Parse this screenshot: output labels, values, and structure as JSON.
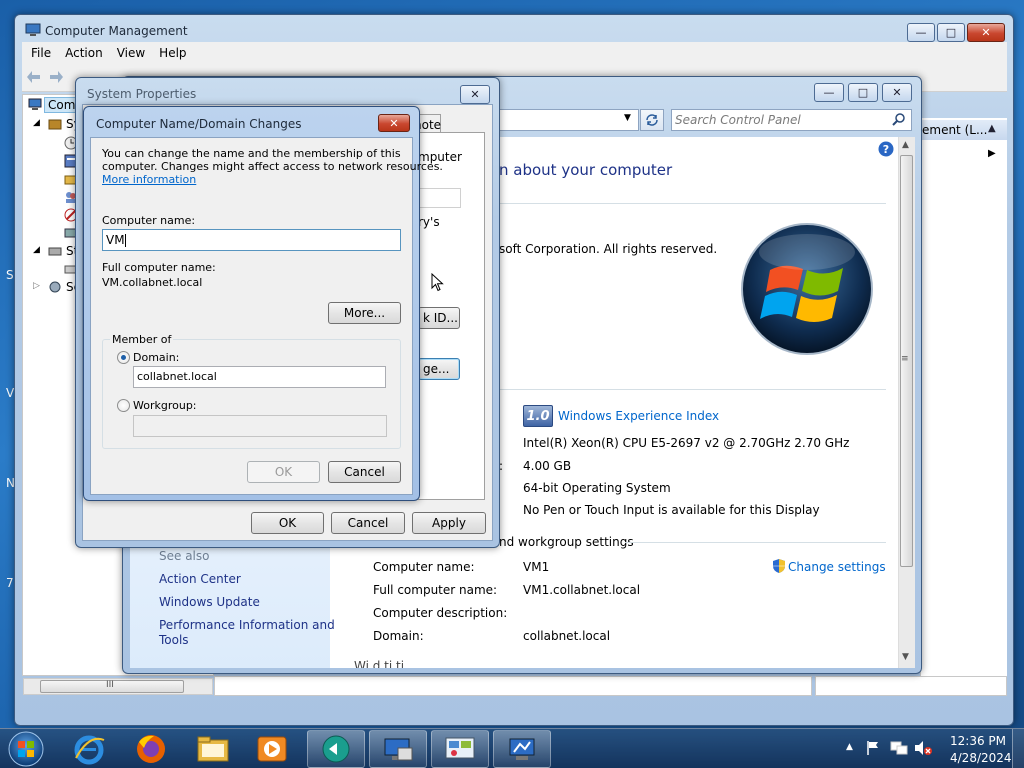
{
  "desktop": {
    "edge_labels": [
      "S",
      "V",
      "N",
      "7"
    ]
  },
  "computer_management": {
    "title": "Computer Management",
    "menu": [
      "File",
      "Action",
      "View",
      "Help"
    ],
    "tree_first": "Comp",
    "tree_items": [
      "Sy",
      "St",
      "Se"
    ],
    "right_panel_header": "ement (L...",
    "status_scroll_label": "III"
  },
  "control_panel": {
    "search_placeholder": "Search Control Panel",
    "heading": "n about your computer",
    "copyright": "soft Corporation.  All rights reserved.",
    "wei_score": "1.0",
    "wei_label": "Windows Experience Index",
    "processor": "Intel(R) Xeon(R) CPU E5-2697 v2 @ 2.70GHz   2.70 GHz",
    "memory_colon": ":",
    "memory": "4.00 GB",
    "system_type": "64-bit Operating System",
    "pen_touch": "No Pen or Touch Input is available for this Display",
    "section_label": "nd workgroup settings",
    "computer_name_label": "Computer name:",
    "computer_name": "VM1",
    "full_name_label": "Full computer name:",
    "full_name": "VM1.collabnet.local",
    "description_label": "Computer description:",
    "domain_label": "Domain:",
    "domain": "collabnet.local",
    "change_settings": "Change settings",
    "see_also": "See also",
    "see_also_links": [
      "Action Center",
      "Windows Update",
      "Performance Information and",
      "Tools"
    ],
    "cut_off_text": "Wi   d   ti   ti"
  },
  "system_properties": {
    "title": "System Properties",
    "tab_partial": "note",
    "partial_text_1": "mputer",
    "partial_text_2": "ry's",
    "partial_button_1": "k ID...",
    "partial_button_2": "ge...",
    "ok": "OK",
    "cancel": "Cancel",
    "apply": "Apply"
  },
  "name_dialog": {
    "title": "Computer Name/Domain Changes",
    "intro": "You can change the name and the membership of this computer. Changes might affect access to network resources.",
    "intro_line1": "You can change the name and the membership of this",
    "intro_line2": "computer. Changes might affect access to network resources.",
    "more_info": "More information",
    "computer_name_label": "Computer name:",
    "computer_name_value": "VM",
    "full_name_label": "Full computer name:",
    "full_name_value": "VM.collabnet.local",
    "more_button": "More...",
    "member_of": "Member of",
    "domain_label": "Domain:",
    "domain_value": "collabnet.local",
    "workgroup_label": "Workgroup:",
    "workgroup_value": "",
    "ok": "OK",
    "cancel": "Cancel",
    "selected_membership": "domain"
  },
  "taskbar": {
    "time": "12:36 PM",
    "date": "4/28/2024",
    "tray_arrow": "▲"
  }
}
